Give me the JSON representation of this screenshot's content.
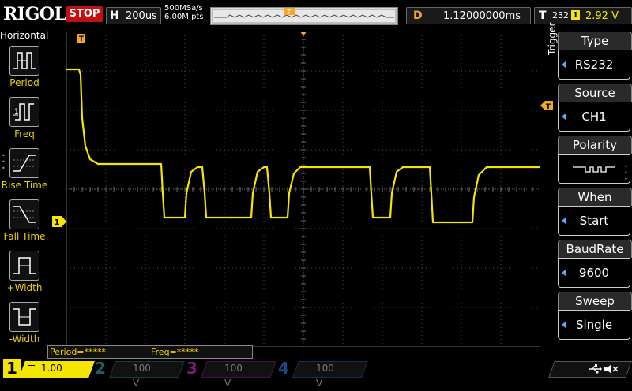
{
  "header": {
    "brand": "RIGOL",
    "run_state": "STOP",
    "timebase_letter": "H",
    "timebase_value": "200us",
    "sample_rate": "500MSa/s",
    "memory_depth": "6.00M pts",
    "delay_letter": "D",
    "delay_value": "1.12000000ms",
    "trigger_letter": "T",
    "trigger_mode": "232",
    "trigger_channel": "1",
    "trigger_level": "2.92 V"
  },
  "left_panel": {
    "title": "Horizontal",
    "items": [
      {
        "label": "Period",
        "icon": "period-icon"
      },
      {
        "label": "Freq",
        "icon": "freq-icon"
      },
      {
        "label": "Rise Time",
        "icon": "rise-time-icon"
      },
      {
        "label": "Fall Time",
        "icon": "fall-time-icon"
      },
      {
        "label": "+Width",
        "icon": "positive-width-icon"
      },
      {
        "label": "-Width",
        "icon": "negative-width-icon"
      }
    ]
  },
  "right_panel": {
    "menu_label": "Trigger",
    "items": [
      {
        "title": "Type",
        "value": "RS232"
      },
      {
        "title": "Source",
        "value": "CH1"
      },
      {
        "title": "Polarity",
        "value": "",
        "icon": "polarity-waveform-icon"
      },
      {
        "title": "When",
        "value": "Start"
      },
      {
        "title": "BaudRate",
        "value": "9600"
      },
      {
        "title": "Sweep",
        "value": "Single"
      }
    ]
  },
  "measurements": {
    "m1": "Period=*****",
    "m2": "Freq=*****"
  },
  "channels": [
    {
      "num": "1",
      "scale": "1.00 V",
      "color": "#f4e600",
      "active": true
    },
    {
      "num": "2",
      "scale": "100 V",
      "color": "#1f5f5f",
      "active": false
    },
    {
      "num": "3",
      "scale": "100 V",
      "color": "#7a1a7a",
      "active": false
    },
    {
      "num": "4",
      "scale": "100 V",
      "color": "#1a4a8a",
      "active": false
    }
  ],
  "markers": {
    "channel1_ground": "1",
    "trigger_position": "T"
  },
  "colors": {
    "trace": "#f4e600",
    "grid": "#4a4a4a",
    "trigger_marker": "#f5a623",
    "stop": "#c21010"
  }
}
